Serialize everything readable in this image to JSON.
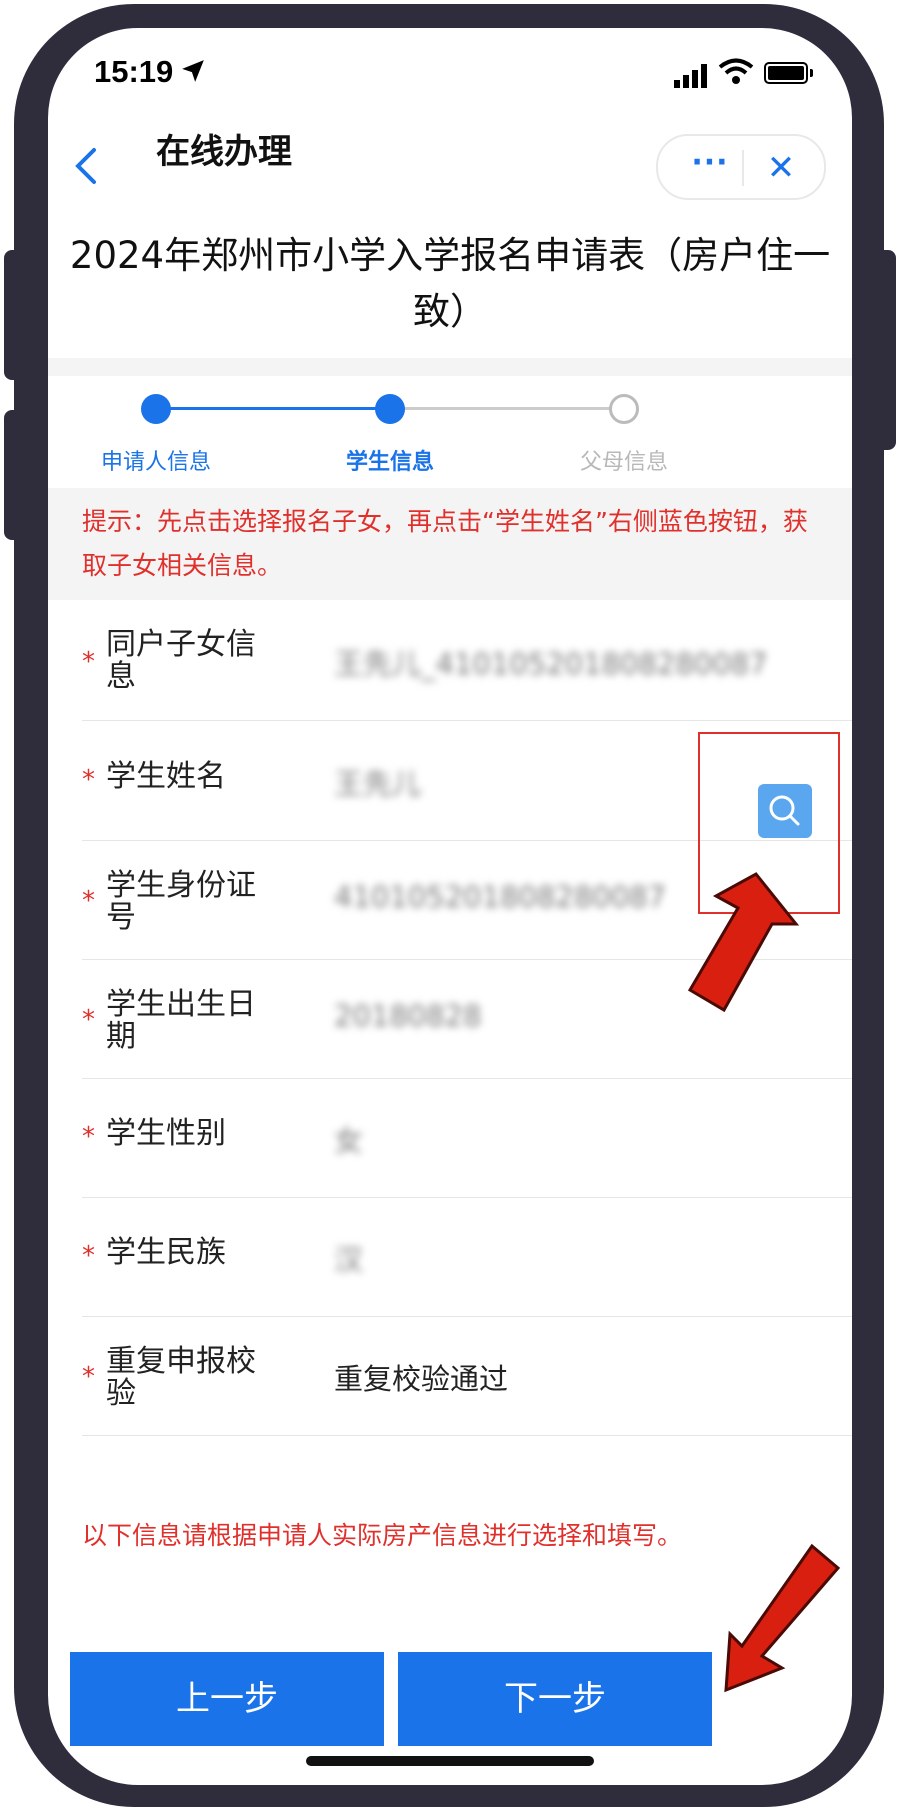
{
  "status_bar": {
    "time": "15:19"
  },
  "nav": {
    "title": "在线办理",
    "more_label": "···",
    "close_label": "✕"
  },
  "form": {
    "title": "2024年郑州市小学入学报名申请表（房户住一致）"
  },
  "steps": [
    {
      "label": "申请人信息",
      "state": "done"
    },
    {
      "label": "学生信息",
      "state": "current"
    },
    {
      "label": "父母信息",
      "state": "pending"
    }
  ],
  "hint": "提示：先点击选择报名子女，再点击“学生姓名”右侧蓝色按钮，获取子女相关信息。",
  "fields": [
    {
      "required_mark": "*",
      "label": "同户子女信息",
      "value": "王先儿_410105201808280087"
    },
    {
      "required_mark": "*",
      "label": "学生姓名",
      "value": "王先儿"
    },
    {
      "required_mark": "*",
      "label": "学生身份证号",
      "value": "410105201808280087"
    },
    {
      "required_mark": "*",
      "label": "学生出生日期",
      "value": "20180828"
    },
    {
      "required_mark": "*",
      "label": "学生性别",
      "value": "女"
    },
    {
      "required_mark": "*",
      "label": "学生民族",
      "value": "汉"
    },
    {
      "required_mark": "*",
      "label": "重复申报校验",
      "value": "重复校验通过"
    }
  ],
  "note": "以下信息请根据申请人实际房产信息进行选择和填写。",
  "buttons": {
    "prev": "上一步",
    "next": "下一步"
  },
  "colors": {
    "primary": "#1a73e8",
    "warning": "#e0302c",
    "annotation": "#d81f10"
  },
  "icons": {
    "back": "chevron-left-icon",
    "search": "search-icon",
    "more": "more-dots-icon",
    "close": "close-icon"
  }
}
